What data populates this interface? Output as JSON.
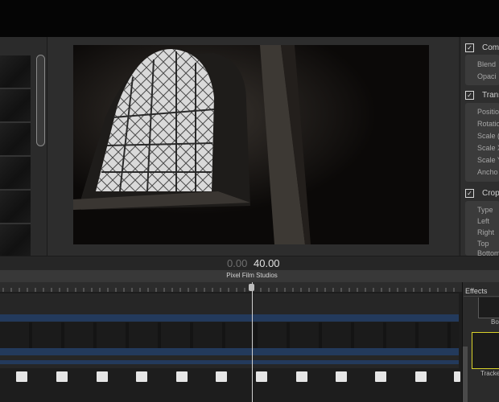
{
  "timecode": {
    "current": "0.00",
    "duration": "40.00"
  },
  "project": {
    "name": "Pixel Film Studios"
  },
  "inspector": {
    "sections": [
      {
        "label": "Comp",
        "checked": true,
        "params": [
          "Blend",
          "Opaci"
        ]
      },
      {
        "label": "Trans",
        "checked": true,
        "params": [
          "Positio",
          "Rotatio",
          "Scale (",
          "Scale X",
          "Scale Y",
          "Ancho"
        ]
      },
      {
        "label": "Crop",
        "checked": true,
        "params": [
          "Type",
          "Left",
          "Right",
          "Top",
          "Bottom"
        ]
      }
    ]
  },
  "effects": {
    "title": "Effects",
    "items": [
      {
        "label": "Bo"
      },
      {
        "label": "Tracke"
      }
    ]
  },
  "colors": {
    "accent_selection": "#d9d22a",
    "track": "#233a5c"
  }
}
